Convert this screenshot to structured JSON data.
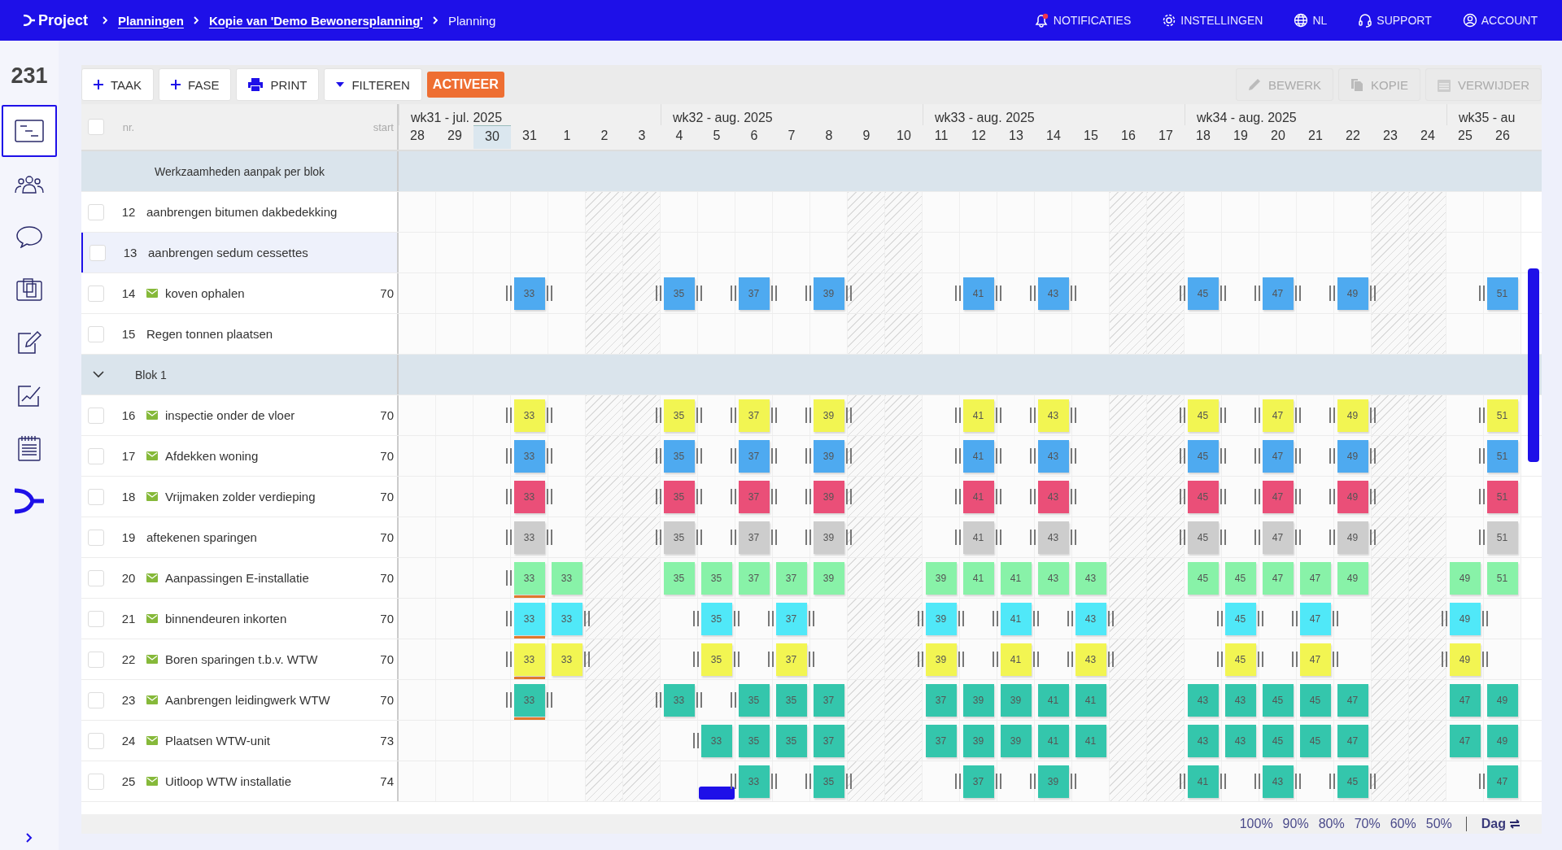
{
  "topbar": {
    "logo": "Project",
    "breadcrumbs": [
      {
        "label": "Planningen",
        "link": true
      },
      {
        "label": "Kopie van 'Demo Bewonersplanning'",
        "link": true
      },
      {
        "label": "Planning",
        "link": false
      }
    ],
    "nav": [
      {
        "label": "NOTIFICATIES",
        "kind": "bell",
        "alert": true
      },
      {
        "label": "INSTELLINGEN",
        "kind": "gear"
      },
      {
        "label": "NL",
        "kind": "globe"
      },
      {
        "label": "SUPPORT",
        "kind": "headset"
      },
      {
        "label": "ACCOUNT",
        "kind": "user"
      }
    ]
  },
  "sidebar": {
    "count": "231",
    "items": [
      {
        "kind": "gantt",
        "selected": true
      },
      {
        "kind": "people",
        "selected": false
      },
      {
        "kind": "chat",
        "selected": false
      },
      {
        "kind": "documents",
        "selected": false
      },
      {
        "kind": "edit",
        "selected": false
      },
      {
        "kind": "chart",
        "selected": false
      },
      {
        "kind": "list",
        "selected": false
      },
      {
        "kind": "logo",
        "selected": false
      }
    ]
  },
  "toolbar": {
    "actions": [
      {
        "label": "TAAK",
        "kind": "plus"
      },
      {
        "label": "FASE",
        "kind": "plus"
      },
      {
        "label": "PRINT",
        "kind": "print"
      },
      {
        "label": "FILTEREN",
        "kind": "filter"
      },
      {
        "label": "ACTIVEER",
        "kind": "highlight"
      }
    ],
    "record_actions": [
      {
        "label": "BEWERK",
        "kind": "pencil",
        "disabled": true
      },
      {
        "label": "KOPIE",
        "kind": "copy",
        "disabled": true
      },
      {
        "label": "VERWIJDER",
        "kind": "calendar",
        "disabled": true
      }
    ]
  },
  "table": {
    "select_all": {
      "checked": false
    },
    "columns": {
      "nr": "nr.",
      "start": "start"
    },
    "weeks": [
      {
        "label": "wk31 - jul. 2025",
        "days": [
          {
            "label": "28",
            "today": false,
            "weekend": false
          },
          {
            "label": "29",
            "today": false,
            "weekend": false
          },
          {
            "label": "30",
            "today": true,
            "weekend": false
          },
          {
            "label": "31",
            "today": false,
            "weekend": false
          },
          {
            "label": "1",
            "today": false,
            "weekend": false
          },
          {
            "label": "2",
            "today": false,
            "weekend": true
          },
          {
            "label": "3",
            "today": false,
            "weekend": true
          }
        ]
      },
      {
        "label": "wk32 - aug. 2025",
        "days": [
          {
            "label": "4",
            "today": false,
            "weekend": false
          },
          {
            "label": "5",
            "today": false,
            "weekend": false
          },
          {
            "label": "6",
            "today": false,
            "weekend": false
          },
          {
            "label": "7",
            "today": false,
            "weekend": false
          },
          {
            "label": "8",
            "today": false,
            "weekend": false
          },
          {
            "label": "9",
            "today": false,
            "weekend": true
          },
          {
            "label": "10",
            "today": false,
            "weekend": true
          }
        ]
      },
      {
        "label": "wk33 - aug. 2025",
        "days": [
          {
            "label": "11",
            "today": false,
            "weekend": false
          },
          {
            "label": "12",
            "today": false,
            "weekend": false
          },
          {
            "label": "13",
            "today": false,
            "weekend": false
          },
          {
            "label": "14",
            "today": false,
            "weekend": false
          },
          {
            "label": "15",
            "today": false,
            "weekend": false
          },
          {
            "label": "16",
            "today": false,
            "weekend": true
          },
          {
            "label": "17",
            "today": false,
            "weekend": true
          }
        ]
      },
      {
        "label": "wk34 - aug. 2025",
        "days": [
          {
            "label": "18",
            "today": false,
            "weekend": false
          },
          {
            "label": "19",
            "today": false,
            "weekend": false
          },
          {
            "label": "20",
            "today": false,
            "weekend": false
          },
          {
            "label": "21",
            "today": false,
            "weekend": false
          },
          {
            "label": "22",
            "today": false,
            "weekend": false
          },
          {
            "label": "23",
            "today": false,
            "weekend": true
          },
          {
            "label": "24",
            "today": false,
            "weekend": true
          }
        ]
      },
      {
        "label": "wk35 - au",
        "days": [
          {
            "label": "25",
            "today": false,
            "weekend": false
          },
          {
            "label": "26",
            "today": false,
            "weekend": false
          }
        ]
      }
    ],
    "groups": [
      {
        "title": "Werkzaamheden aanpak per blok",
        "rows": [
          {
            "nr": "12",
            "name": "aanbrengen bitumen dakbedekking",
            "mail": false,
            "checked": false,
            "selected": false
          },
          {
            "nr": "13",
            "name": "aanbrengen sedum cessettes",
            "mail": false,
            "checked": false,
            "selected": true
          },
          {
            "nr": "14",
            "name": "koven ophalen",
            "mail": true,
            "start": "70",
            "checked": false,
            "selected": false,
            "color": "#4eaaf0",
            "cells": [
              null,
              null,
              null,
              {
                "text": "33",
                "grip_left": true,
                "grip_right": true
              },
              null,
              null,
              null,
              {
                "text": "35",
                "grip_left": true,
                "grip_right": true
              },
              null,
              {
                "text": "37",
                "grip_left": true,
                "grip_right": true
              },
              null,
              {
                "text": "39",
                "grip_left": true,
                "grip_right": true
              },
              null,
              null,
              null,
              {
                "text": "41",
                "grip_left": true,
                "grip_right": true
              },
              null,
              {
                "text": "43",
                "grip_left": true,
                "grip_right": true
              },
              null,
              null,
              null,
              {
                "text": "45",
                "grip_left": true,
                "grip_right": true
              },
              null,
              {
                "text": "47",
                "grip_left": true,
                "grip_right": true
              },
              null,
              {
                "text": "49",
                "grip_left": true,
                "grip_right": true
              },
              null,
              null,
              null,
              {
                "text": "51",
                "grip_left": true,
                "grip_right": false
              }
            ]
          },
          {
            "nr": "15",
            "name": "Regen tonnen plaatsen",
            "mail": false,
            "checked": false,
            "selected": false
          }
        ]
      },
      {
        "title": "Blok 1",
        "expanded": true,
        "rows": [
          {
            "nr": "16",
            "name": "inspectie onder de vloer",
            "mail": true,
            "start": "70",
            "checked": false,
            "selected": false,
            "color": "#f2f552",
            "cells": [
              null,
              null,
              null,
              {
                "text": "33",
                "grip_left": true,
                "grip_right": true
              },
              null,
              null,
              null,
              {
                "text": "35",
                "grip_left": true,
                "grip_right": true
              },
              null,
              {
                "text": "37",
                "grip_left": true,
                "grip_right": true
              },
              null,
              {
                "text": "39",
                "grip_left": true,
                "grip_right": true
              },
              null,
              null,
              null,
              {
                "text": "41",
                "grip_left": true,
                "grip_right": true
              },
              null,
              {
                "text": "43",
                "grip_left": true,
                "grip_right": true
              },
              null,
              null,
              null,
              {
                "text": "45",
                "grip_left": true,
                "grip_right": true
              },
              null,
              {
                "text": "47",
                "grip_left": true,
                "grip_right": true
              },
              null,
              {
                "text": "49",
                "grip_left": true,
                "grip_right": true
              },
              null,
              null,
              null,
              {
                "text": "51",
                "grip_left": true,
                "grip_right": false
              }
            ]
          },
          {
            "nr": "17",
            "name": "Afdekken woning",
            "mail": true,
            "start": "70",
            "checked": false,
            "selected": false,
            "color": "#4eaaf0",
            "cells": [
              null,
              null,
              null,
              {
                "text": "33",
                "grip_left": true,
                "grip_right": true
              },
              null,
              null,
              null,
              {
                "text": "35",
                "grip_left": true,
                "grip_right": true
              },
              null,
              {
                "text": "37",
                "grip_left": true,
                "grip_right": true
              },
              null,
              {
                "text": "39",
                "grip_left": true,
                "grip_right": true
              },
              null,
              null,
              null,
              {
                "text": "41",
                "grip_left": true,
                "grip_right": true
              },
              null,
              {
                "text": "43",
                "grip_left": true,
                "grip_right": true
              },
              null,
              null,
              null,
              {
                "text": "45",
                "grip_left": true,
                "grip_right": true
              },
              null,
              {
                "text": "47",
                "grip_left": true,
                "grip_right": true
              },
              null,
              {
                "text": "49",
                "grip_left": true,
                "grip_right": true
              },
              null,
              null,
              null,
              {
                "text": "51",
                "grip_left": true,
                "grip_right": false
              }
            ]
          },
          {
            "nr": "18",
            "name": "Vrijmaken zolder verdieping",
            "mail": true,
            "start": "70",
            "checked": false,
            "selected": false,
            "color": "#ea4f78",
            "cells": [
              null,
              null,
              null,
              {
                "text": "33",
                "grip_left": true,
                "grip_right": true
              },
              null,
              null,
              null,
              {
                "text": "35",
                "grip_left": true,
                "grip_right": true
              },
              null,
              {
                "text": "37",
                "grip_left": true,
                "grip_right": true
              },
              null,
              {
                "text": "39",
                "grip_left": true,
                "grip_right": true
              },
              null,
              null,
              null,
              {
                "text": "41",
                "grip_left": true,
                "grip_right": true
              },
              null,
              {
                "text": "43",
                "grip_left": true,
                "grip_right": true
              },
              null,
              null,
              null,
              {
                "text": "45",
                "grip_left": true,
                "grip_right": true
              },
              null,
              {
                "text": "47",
                "grip_left": true,
                "grip_right": true
              },
              null,
              {
                "text": "49",
                "grip_left": true,
                "grip_right": true
              },
              null,
              null,
              null,
              {
                "text": "51",
                "grip_left": true,
                "grip_right": false
              }
            ]
          },
          {
            "nr": "19",
            "name": "aftekenen sparingen",
            "mail": false,
            "start": "70",
            "checked": false,
            "selected": false,
            "color": "#cdcdcd",
            "cells": [
              null,
              null,
              null,
              {
                "text": "33",
                "grip_left": true,
                "grip_right": true
              },
              null,
              null,
              null,
              {
                "text": "35",
                "grip_left": true,
                "grip_right": true
              },
              null,
              {
                "text": "37",
                "grip_left": true,
                "grip_right": true
              },
              null,
              {
                "text": "39",
                "grip_left": true,
                "grip_right": true
              },
              null,
              null,
              null,
              {
                "text": "41",
                "grip_left": true,
                "grip_right": true
              },
              null,
              {
                "text": "43",
                "grip_left": true,
                "grip_right": true
              },
              null,
              null,
              null,
              {
                "text": "45",
                "grip_left": true,
                "grip_right": true
              },
              null,
              {
                "text": "47",
                "grip_left": true,
                "grip_right": true
              },
              null,
              {
                "text": "49",
                "grip_left": true,
                "grip_right": true
              },
              null,
              null,
              null,
              {
                "text": "51",
                "grip_left": true,
                "grip_right": false
              }
            ]
          },
          {
            "nr": "20",
            "name": "Aanpassingen E-installatie",
            "mail": true,
            "start": "70",
            "checked": false,
            "selected": false,
            "color": "#88f2a8",
            "cells": [
              null,
              null,
              null,
              {
                "text": "33",
                "grip_left": true,
                "grip_right": false,
                "underline": true
              },
              {
                "text": "33",
                "grip_left": false,
                "grip_right": false
              },
              null,
              null,
              {
                "text": "35",
                "grip_left": false,
                "grip_right": false
              },
              {
                "text": "35",
                "grip_left": false,
                "grip_right": false
              },
              {
                "text": "37",
                "grip_left": false,
                "grip_right": false
              },
              {
                "text": "37",
                "grip_left": false,
                "grip_right": false
              },
              {
                "text": "39",
                "grip_left": false,
                "grip_right": false
              },
              null,
              null,
              {
                "text": "39",
                "grip_left": false,
                "grip_right": false
              },
              {
                "text": "41",
                "grip_left": false,
                "grip_right": false
              },
              {
                "text": "41",
                "grip_left": false,
                "grip_right": false
              },
              {
                "text": "43",
                "grip_left": false,
                "grip_right": false
              },
              {
                "text": "43",
                "grip_left": false,
                "grip_right": false
              },
              null,
              null,
              {
                "text": "45",
                "grip_left": false,
                "grip_right": false
              },
              {
                "text": "45",
                "grip_left": false,
                "grip_right": false
              },
              {
                "text": "47",
                "grip_left": false,
                "grip_right": false
              },
              {
                "text": "47",
                "grip_left": false,
                "grip_right": false
              },
              {
                "text": "49",
                "grip_left": false,
                "grip_right": false
              },
              null,
              null,
              {
                "text": "49",
                "grip_left": false,
                "grip_right": false
              },
              {
                "text": "51",
                "grip_left": false,
                "grip_right": false
              }
            ]
          },
          {
            "nr": "21",
            "name": "binnendeuren inkorten",
            "mail": true,
            "start": "70",
            "checked": false,
            "selected": false,
            "color": "#50e8f8",
            "cells": [
              null,
              null,
              null,
              {
                "text": "33",
                "grip_left": true,
                "grip_right": false,
                "underline": true
              },
              {
                "text": "33",
                "grip_left": false,
                "grip_right": true
              },
              null,
              null,
              null,
              {
                "text": "35",
                "grip_left": true,
                "grip_right": true
              },
              null,
              {
                "text": "37",
                "grip_left": true,
                "grip_right": true
              },
              null,
              null,
              null,
              {
                "text": "39",
                "grip_left": true,
                "grip_right": true
              },
              null,
              {
                "text": "41",
                "grip_left": true,
                "grip_right": true
              },
              null,
              {
                "text": "43",
                "grip_left": true,
                "grip_right": true
              },
              null,
              null,
              null,
              {
                "text": "45",
                "grip_left": true,
                "grip_right": true
              },
              null,
              {
                "text": "47",
                "grip_left": true,
                "grip_right": true
              },
              null,
              null,
              null,
              {
                "text": "49",
                "grip_left": true,
                "grip_right": true
              },
              null
            ]
          },
          {
            "nr": "22",
            "name": "Boren sparingen t.b.v. WTW",
            "mail": true,
            "start": "70",
            "checked": false,
            "selected": false,
            "color": "#f2f552",
            "cells": [
              null,
              null,
              null,
              {
                "text": "33",
                "grip_left": true,
                "grip_right": false,
                "underline": true
              },
              {
                "text": "33",
                "grip_left": false,
                "grip_right": true
              },
              null,
              null,
              null,
              {
                "text": "35",
                "grip_left": true,
                "grip_right": true
              },
              null,
              {
                "text": "37",
                "grip_left": true,
                "grip_right": true
              },
              null,
              null,
              null,
              {
                "text": "39",
                "grip_left": true,
                "grip_right": true
              },
              null,
              {
                "text": "41",
                "grip_left": true,
                "grip_right": true
              },
              null,
              {
                "text": "43",
                "grip_left": true,
                "grip_right": true
              },
              null,
              null,
              null,
              {
                "text": "45",
                "grip_left": true,
                "grip_right": true
              },
              null,
              {
                "text": "47",
                "grip_left": true,
                "grip_right": true
              },
              null,
              null,
              null,
              {
                "text": "49",
                "grip_left": true,
                "grip_right": true
              },
              null
            ]
          },
          {
            "nr": "23",
            "name": "Aanbrengen leidingwerk WTW",
            "mail": true,
            "start": "70",
            "checked": false,
            "selected": false,
            "color": "#34c6ac",
            "cells": [
              null,
              null,
              null,
              {
                "text": "33",
                "grip_left": true,
                "grip_right": true,
                "underline": true
              },
              null,
              null,
              null,
              {
                "text": "33",
                "grip_left": true,
                "grip_right": true
              },
              null,
              {
                "text": "35",
                "grip_left": true,
                "grip_right": false
              },
              {
                "text": "35",
                "grip_left": false,
                "grip_right": false
              },
              {
                "text": "37",
                "grip_left": false,
                "grip_right": false
              },
              null,
              null,
              {
                "text": "37",
                "grip_left": false,
                "grip_right": false
              },
              {
                "text": "39",
                "grip_left": false,
                "grip_right": false
              },
              {
                "text": "39",
                "grip_left": false,
                "grip_right": false
              },
              {
                "text": "41",
                "grip_left": false,
                "grip_right": false
              },
              {
                "text": "41",
                "grip_left": false,
                "grip_right": false
              },
              null,
              null,
              {
                "text": "43",
                "grip_left": false,
                "grip_right": false
              },
              {
                "text": "43",
                "grip_left": false,
                "grip_right": false
              },
              {
                "text": "45",
                "grip_left": false,
                "grip_right": false
              },
              {
                "text": "45",
                "grip_left": false,
                "grip_right": false
              },
              {
                "text": "47",
                "grip_left": false,
                "grip_right": false
              },
              null,
              null,
              {
                "text": "47",
                "grip_left": false,
                "grip_right": false
              },
              {
                "text": "49",
                "grip_left": false,
                "grip_right": false
              }
            ]
          },
          {
            "nr": "24",
            "name": "Plaatsen WTW-unit",
            "mail": true,
            "start": "73",
            "checked": false,
            "selected": false,
            "color": "#34c6ac",
            "cells": [
              null,
              null,
              null,
              null,
              null,
              null,
              null,
              null,
              {
                "text": "33",
                "grip_left": true,
                "grip_right": false
              },
              {
                "text": "35",
                "grip_left": false,
                "grip_right": false
              },
              {
                "text": "35",
                "grip_left": false,
                "grip_right": false
              },
              {
                "text": "37",
                "grip_left": false,
                "grip_right": false
              },
              null,
              null,
              {
                "text": "37",
                "grip_left": false,
                "grip_right": false
              },
              {
                "text": "39",
                "grip_left": false,
                "grip_right": false
              },
              {
                "text": "39",
                "grip_left": false,
                "grip_right": false
              },
              {
                "text": "41",
                "grip_left": false,
                "grip_right": false
              },
              {
                "text": "41",
                "grip_left": false,
                "grip_right": false
              },
              null,
              null,
              {
                "text": "43",
                "grip_left": false,
                "grip_right": false
              },
              {
                "text": "43",
                "grip_left": false,
                "grip_right": false
              },
              {
                "text": "45",
                "grip_left": false,
                "grip_right": false
              },
              {
                "text": "45",
                "grip_left": false,
                "grip_right": false
              },
              {
                "text": "47",
                "grip_left": false,
                "grip_right": false
              },
              null,
              null,
              {
                "text": "47",
                "grip_left": false,
                "grip_right": false
              },
              {
                "text": "49",
                "grip_left": false,
                "grip_right": false
              }
            ]
          },
          {
            "nr": "25",
            "name": "Uitloop WTW installatie",
            "mail": true,
            "start": "74",
            "checked": false,
            "selected": false,
            "color": "#34c6ac",
            "cells": [
              null,
              null,
              null,
              null,
              null,
              null,
              null,
              null,
              {
                "kind": "handle"
              },
              {
                "text": "33",
                "grip_left": true,
                "grip_right": true
              },
              null,
              {
                "text": "35",
                "grip_left": true,
                "grip_right": true
              },
              null,
              null,
              null,
              {
                "text": "37",
                "grip_left": true,
                "grip_right": true
              },
              null,
              {
                "text": "39",
                "grip_left": true,
                "grip_right": true
              },
              null,
              null,
              null,
              {
                "text": "41",
                "grip_left": true,
                "grip_right": true
              },
              null,
              {
                "text": "43",
                "grip_left": true,
                "grip_right": true
              },
              null,
              {
                "text": "45",
                "grip_left": true,
                "grip_right": true
              },
              null,
              null,
              null,
              {
                "text": "47",
                "grip_left": true,
                "grip_right": false
              }
            ]
          }
        ]
      }
    ]
  },
  "footer": {
    "zoom_levels": [
      "100%",
      "90%",
      "80%",
      "70%",
      "60%",
      "50%"
    ],
    "scale": "Dag"
  }
}
